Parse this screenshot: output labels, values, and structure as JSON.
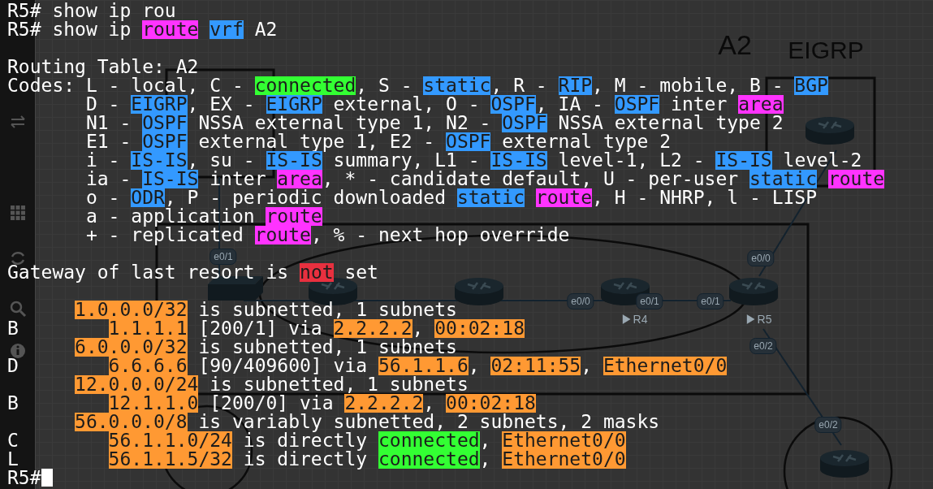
{
  "diagram": {
    "area_labels": [
      "A2",
      "EIGRP"
    ],
    "port_labels": [
      "e0/1",
      "e0/0",
      "e0/1",
      "e0/1",
      "e0/0",
      "e0/2",
      "e0/2"
    ],
    "router_labels": [
      "R4",
      "R5"
    ]
  },
  "terminal": {
    "lines": [
      {
        "kind": "text",
        "segments": [
          {
            "text": "R5# show ip rou"
          }
        ]
      },
      {
        "kind": "text",
        "segments": [
          {
            "text": "R5# show ip "
          },
          {
            "text": "route",
            "color": "#ff33ff"
          },
          {
            "text": "vrf",
            "color": "#3399ff",
            "gap": true
          },
          {
            "text": " A2"
          }
        ]
      },
      {
        "kind": "blank"
      },
      {
        "kind": "text",
        "segments": [
          {
            "text": "Routing Table: A2"
          }
        ]
      },
      {
        "kind": "text",
        "segments": [
          {
            "text": "Codes: L - local, C - "
          },
          {
            "text": "connected",
            "color": "#33ff33"
          },
          {
            "text": ", S - "
          },
          {
            "text": "static",
            "color": "#3399ff"
          },
          {
            "text": ", R - "
          },
          {
            "text": "RIP",
            "color": "#3399ff"
          },
          {
            "text": ", M - mobile, B - "
          },
          {
            "text": "BGP",
            "color": "#3399ff"
          }
        ]
      },
      {
        "kind": "code",
        "segments": [
          {
            "text": "D - "
          },
          {
            "text": "EIGRP",
            "color": "#3399ff"
          },
          {
            "text": ", EX - "
          },
          {
            "text": "EIGRP",
            "color": "#3399ff"
          },
          {
            "text": " external, O - "
          },
          {
            "text": "OSPF",
            "color": "#3399ff"
          },
          {
            "text": ", IA - "
          },
          {
            "text": "OSPF",
            "color": "#3399ff"
          },
          {
            "text": " inter "
          },
          {
            "text": "area",
            "color": "#ff33ff"
          }
        ]
      },
      {
        "kind": "code",
        "segments": [
          {
            "text": "N1 - "
          },
          {
            "text": "OSPF",
            "color": "#3399ff"
          },
          {
            "text": " NSSA external type 1, N2 - "
          },
          {
            "text": "OSPF",
            "color": "#3399ff"
          },
          {
            "text": " NSSA external type 2"
          }
        ]
      },
      {
        "kind": "code",
        "segments": [
          {
            "text": "E1 - "
          },
          {
            "text": "OSPF",
            "color": "#3399ff"
          },
          {
            "text": " external type 1, E2 - "
          },
          {
            "text": "OSPF",
            "color": "#3399ff"
          },
          {
            "text": " external type 2"
          }
        ]
      },
      {
        "kind": "code",
        "segments": [
          {
            "text": "i - "
          },
          {
            "text": "IS-IS",
            "color": "#3399ff"
          },
          {
            "text": ", su - "
          },
          {
            "text": "IS-IS",
            "color": "#3399ff"
          },
          {
            "text": " summary, L1 - "
          },
          {
            "text": "IS-IS",
            "color": "#3399ff"
          },
          {
            "text": " level-1, L2 - "
          },
          {
            "text": "IS-IS",
            "color": "#3399ff"
          },
          {
            "text": " level-2"
          }
        ]
      },
      {
        "kind": "code",
        "segments": [
          {
            "text": "ia - "
          },
          {
            "text": "IS-IS",
            "color": "#3399ff"
          },
          {
            "text": " inter "
          },
          {
            "text": "area",
            "color": "#ff33ff"
          },
          {
            "text": ", * - candidate default, U - per-user "
          },
          {
            "text": "static",
            "color": "#3399ff"
          },
          {
            "text": "route",
            "color": "#ff33ff",
            "gap": true
          }
        ]
      },
      {
        "kind": "code",
        "segments": [
          {
            "text": "o - "
          },
          {
            "text": "ODR",
            "color": "#3399ff"
          },
          {
            "text": ", P - periodic downloaded "
          },
          {
            "text": "static",
            "color": "#3399ff"
          },
          {
            "text": "route",
            "color": "#ff33ff",
            "gap": true
          },
          {
            "text": ", H - NHRP, l - LISP"
          }
        ]
      },
      {
        "kind": "code",
        "segments": [
          {
            "text": "a - application "
          },
          {
            "text": "route",
            "color": "#ff33ff"
          }
        ]
      },
      {
        "kind": "code",
        "segments": [
          {
            "text": "+ - replicated "
          },
          {
            "text": "route",
            "color": "#ff33ff"
          },
          {
            "text": ", % - next hop override"
          }
        ]
      },
      {
        "kind": "blank"
      },
      {
        "kind": "text",
        "segments": [
          {
            "text": "Gateway of last resort is "
          },
          {
            "text": "not",
            "color": "#e8303f"
          },
          {
            "text": " set"
          }
        ]
      },
      {
        "kind": "blank"
      },
      {
        "kind": "subnet",
        "segments": [
          {
            "text": "1.0.0.0/32",
            "color": "#ff9933"
          },
          {
            "text": " is subnetted, 1 subnets"
          }
        ]
      },
      {
        "kind": "route",
        "segments": [
          {
            "text": "B"
          },
          {
            "text": "1.1.1.1",
            "color": "#ff9933"
          },
          {
            "text": " [200/1] via "
          },
          {
            "text": "2.2.2.2",
            "color": "#ff9933"
          },
          {
            "text": ", "
          },
          {
            "text": "00:02:18",
            "color": "#ff9933"
          }
        ]
      },
      {
        "kind": "subnet",
        "segments": [
          {
            "text": "6.0.0.0/32",
            "color": "#ff9933"
          },
          {
            "text": " is subnetted, 1 subnets"
          }
        ]
      },
      {
        "kind": "route",
        "segments": [
          {
            "text": "D"
          },
          {
            "text": "6.6.6.6",
            "color": "#ff9933"
          },
          {
            "text": " [90/409600] via "
          },
          {
            "text": "56.1.1.6",
            "color": "#ff9933"
          },
          {
            "text": ", "
          },
          {
            "text": "02:11:55",
            "color": "#ff9933"
          },
          {
            "text": ", "
          },
          {
            "text": "Ethernet0/0",
            "color": "#ff9933"
          }
        ]
      },
      {
        "kind": "subnet",
        "segments": [
          {
            "text": "12.0.0.0/24",
            "color": "#ff9933"
          },
          {
            "text": " is subnetted, 1 subnets"
          }
        ]
      },
      {
        "kind": "route",
        "segments": [
          {
            "text": "B"
          },
          {
            "text": "12.1.1.0",
            "color": "#ff9933"
          },
          {
            "text": " [200/0] via "
          },
          {
            "text": "2.2.2.2",
            "color": "#ff9933"
          },
          {
            "text": ", "
          },
          {
            "text": "00:02:18",
            "color": "#ff9933"
          }
        ]
      },
      {
        "kind": "subnet",
        "segments": [
          {
            "text": "56.0.0.0/8",
            "color": "#ff9933"
          },
          {
            "text": " is variably subnetted, 2 subnets, 2 masks"
          }
        ]
      },
      {
        "kind": "route",
        "segments": [
          {
            "text": "C"
          },
          {
            "text": "56.1.1.0/24",
            "color": "#ff9933"
          },
          {
            "text": " is directly "
          },
          {
            "text": "connected",
            "color": "#33ff33"
          },
          {
            "text": ", "
          },
          {
            "text": "Ethernet0/0",
            "color": "#ff9933"
          }
        ]
      },
      {
        "kind": "route",
        "segments": [
          {
            "text": "L"
          },
          {
            "text": "56.1.1.5/32",
            "color": "#ff9933"
          },
          {
            "text": " is directly "
          },
          {
            "text": "connected",
            "color": "#33ff33"
          },
          {
            "text": ", "
          },
          {
            "text": "Ethernet0/0",
            "color": "#ff9933"
          }
        ]
      },
      {
        "kind": "prompt",
        "segments": [
          {
            "text": "R5#"
          }
        ]
      }
    ]
  }
}
